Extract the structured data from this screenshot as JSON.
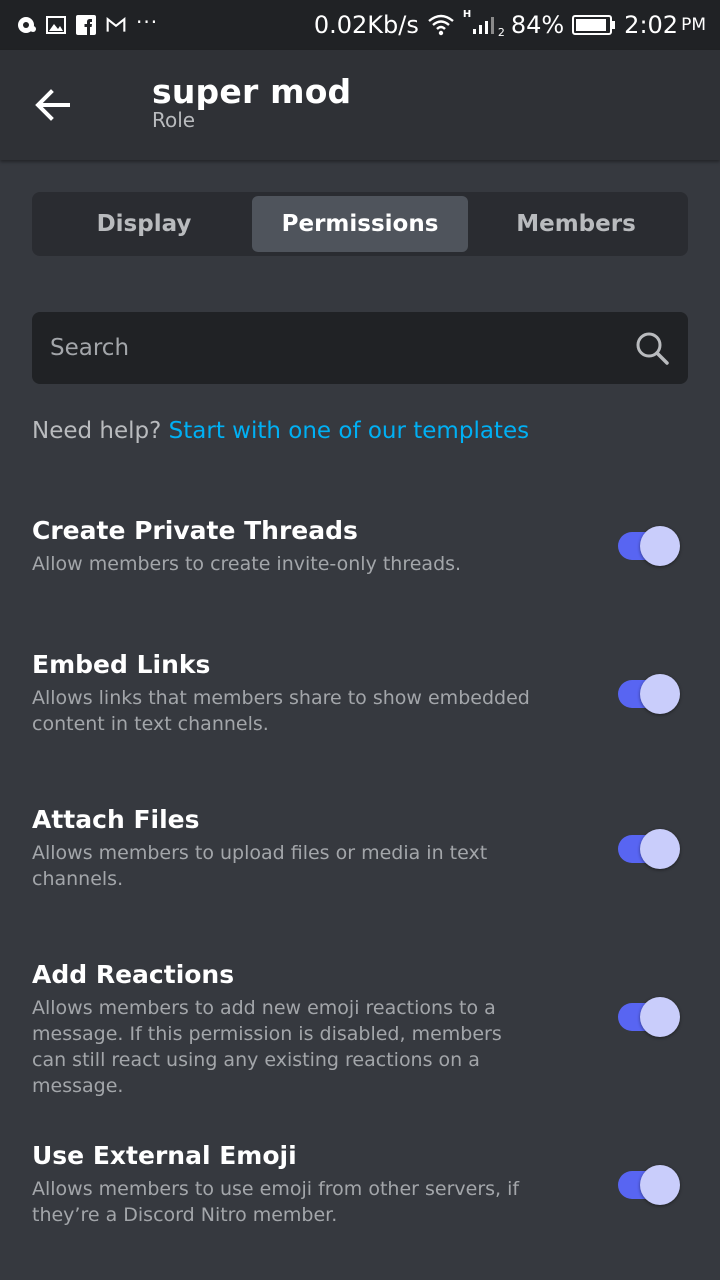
{
  "status_bar": {
    "network_speed": "0.02Kb/s",
    "signal_label": "H",
    "sim_slot": "2",
    "battery": "84%",
    "time": "2:02",
    "ampm": "PM",
    "more": "···"
  },
  "header": {
    "title": "super mod",
    "subtitle": "Role"
  },
  "tabs": [
    {
      "label": "Display",
      "active": false
    },
    {
      "label": "Permissions",
      "active": true
    },
    {
      "label": "Members",
      "active": false
    }
  ],
  "search": {
    "placeholder": "Search",
    "value": ""
  },
  "help": {
    "prefix": "Need help?",
    "link": "Start with one of our templates"
  },
  "permissions": [
    {
      "title": "Create Private Threads",
      "description": "Allow members to create invite-only threads.",
      "enabled": true
    },
    {
      "title": "Embed Links",
      "description": "Allows links that members share to show embedded content in text channels.",
      "enabled": true
    },
    {
      "title": "Attach Files",
      "description": "Allows members to upload files or media in text channels.",
      "enabled": true
    },
    {
      "title": "Add Reactions",
      "description": "Allows members to add new emoji reactions to a message. If this permission is disabled, members can still react using any existing reactions on a message.",
      "enabled": true
    },
    {
      "title": "Use External Emoji",
      "description": "Allows members to use emoji from other servers, if they’re a Discord Nitro member.",
      "enabled": true
    }
  ],
  "colors": {
    "background": "#36393f",
    "header": "#2f3136",
    "accent": "#5865f2",
    "link": "#00b0f4"
  }
}
